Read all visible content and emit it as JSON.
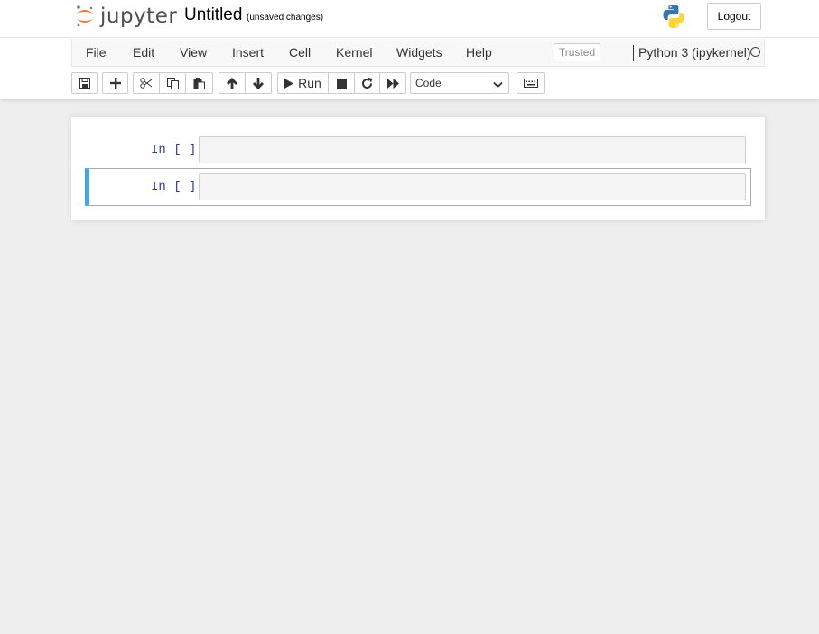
{
  "header": {
    "logo_text": "jupyter",
    "notebook_title": "Untitled",
    "save_status": "(unsaved changes)",
    "logout_label": "Logout"
  },
  "menubar": {
    "items": [
      "File",
      "Edit",
      "View",
      "Insert",
      "Cell",
      "Kernel",
      "Widgets",
      "Help"
    ],
    "trusted_label": "Trusted",
    "kernel_name": "Python 3 (ipykernel)"
  },
  "toolbar": {
    "run_label": "Run",
    "cell_type": "Code",
    "icons": [
      "save-icon",
      "plus-icon",
      "cut-icon",
      "copy-icon",
      "paste-icon",
      "arrow-up-icon",
      "arrow-down-icon",
      "play-icon",
      "stop-icon",
      "restart-icon",
      "fast-forward-icon",
      "keyboard-icon"
    ]
  },
  "cells": [
    {
      "prompt": "In [ ]:",
      "source": "",
      "selected": false
    },
    {
      "prompt": "In [ ]:",
      "source": "",
      "selected": true
    }
  ],
  "colors": {
    "accent": "#42a5f5",
    "prompt": "#303f9f",
    "background": "#eeeeee",
    "logo_orange": "#f37726"
  }
}
